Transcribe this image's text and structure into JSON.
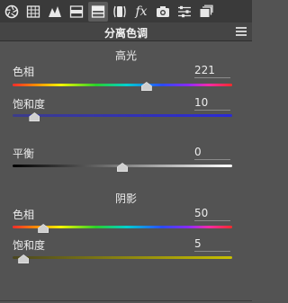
{
  "toolbar": {
    "tools": [
      {
        "icon": "aperture-icon"
      },
      {
        "icon": "grid-icon"
      },
      {
        "icon": "curve-mountain-icon"
      },
      {
        "icon": "hsl-panel-icon"
      },
      {
        "icon": "split-toning-icon",
        "selected": true
      },
      {
        "icon": "lens-icon"
      },
      {
        "icon": "fx-icon",
        "label": "fx"
      },
      {
        "icon": "camera-icon"
      },
      {
        "icon": "sliders-icon"
      },
      {
        "icon": "presets-icon"
      }
    ]
  },
  "panel": {
    "title": "分离色调"
  },
  "highlights": {
    "heading": "高光",
    "hue": {
      "label": "色相",
      "value": "221",
      "fraction": 0.61
    },
    "saturation": {
      "label": "饱和度",
      "value": "10",
      "fraction": 0.1
    }
  },
  "balance": {
    "label": "平衡",
    "value": "0",
    "fraction": 0.5
  },
  "shadows": {
    "heading": "阴影",
    "hue": {
      "label": "色相",
      "value": "50",
      "fraction": 0.14
    },
    "saturation": {
      "label": "饱和度",
      "value": "5",
      "fraction": 0.05
    }
  },
  "colors": {
    "toolbar_bg": "#3a3a3a",
    "panel_bg": "#535353",
    "header_bg": "#454545",
    "text": "#ececec"
  }
}
